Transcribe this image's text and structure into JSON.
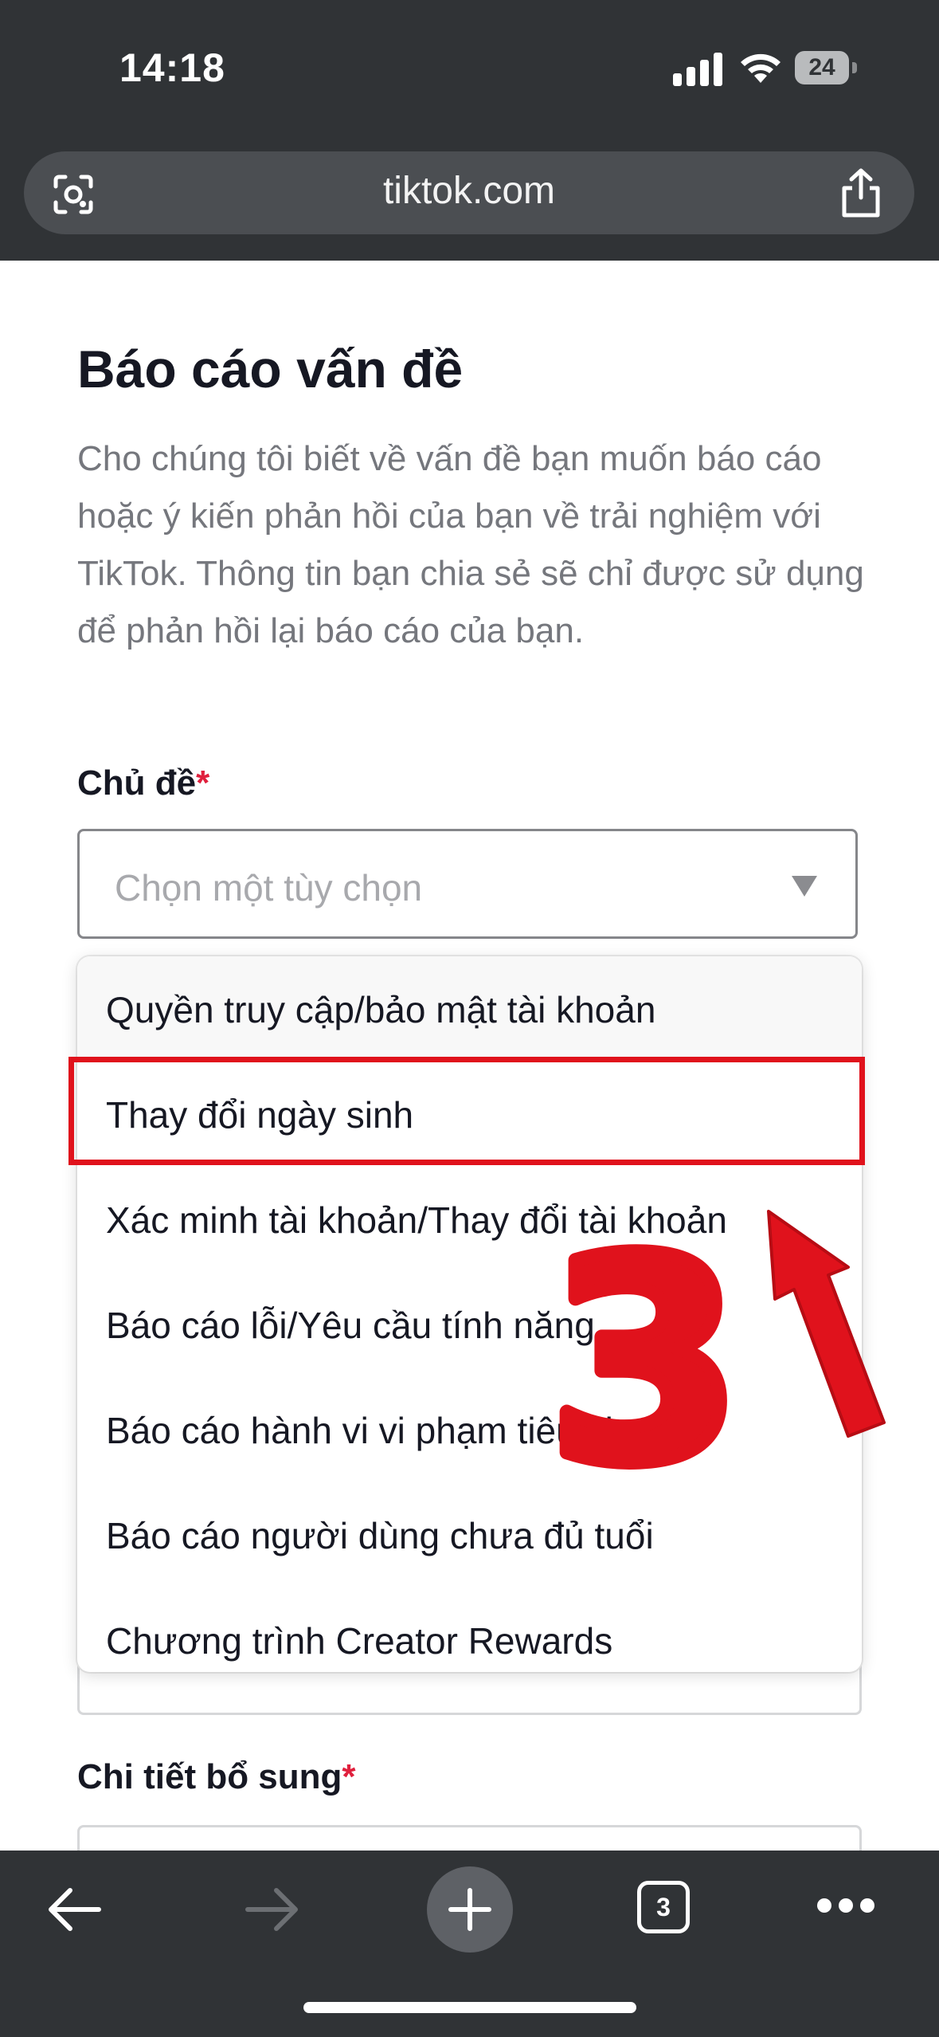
{
  "status_bar": {
    "time": "14:18",
    "battery": "24"
  },
  "browser": {
    "url": "tiktok.com",
    "tab_count": "3"
  },
  "page": {
    "title": "Báo cáo vấn đề",
    "description": "Cho chúng tôi biết về vấn đề bạn muốn báo cáo hoặc ý kiến phản hồi của bạn về trải nghiệm với TikTok. Thông tin bạn chia sẻ sẽ chỉ được sử dụng để phản hồi lại báo cáo của bạn.",
    "topic_label": "Chủ đề",
    "required_mark": "*",
    "topic_placeholder": "Chọn một tùy chọn",
    "details_label": "Chi tiết bổ sung"
  },
  "dropdown": {
    "options": [
      "Quyền truy cập/bảo mật tài khoản",
      "Thay đổi ngày sinh",
      "Xác minh tài khoản/Thay đổi tài khoản",
      "Báo cáo lỗi/Yêu cầu tính năng",
      "Báo cáo hành vi vi phạm tiêu chuẩn",
      "Báo cáo người dùng chưa đủ tuổi",
      "Chương trình Creator Rewards"
    ],
    "highlighted_index": 1
  },
  "annotation": {
    "step_number": "3",
    "color": "#e0121c"
  },
  "colors": {
    "chrome": "#303336",
    "required": "#e0203d",
    "accent_red": "#e0121c"
  }
}
